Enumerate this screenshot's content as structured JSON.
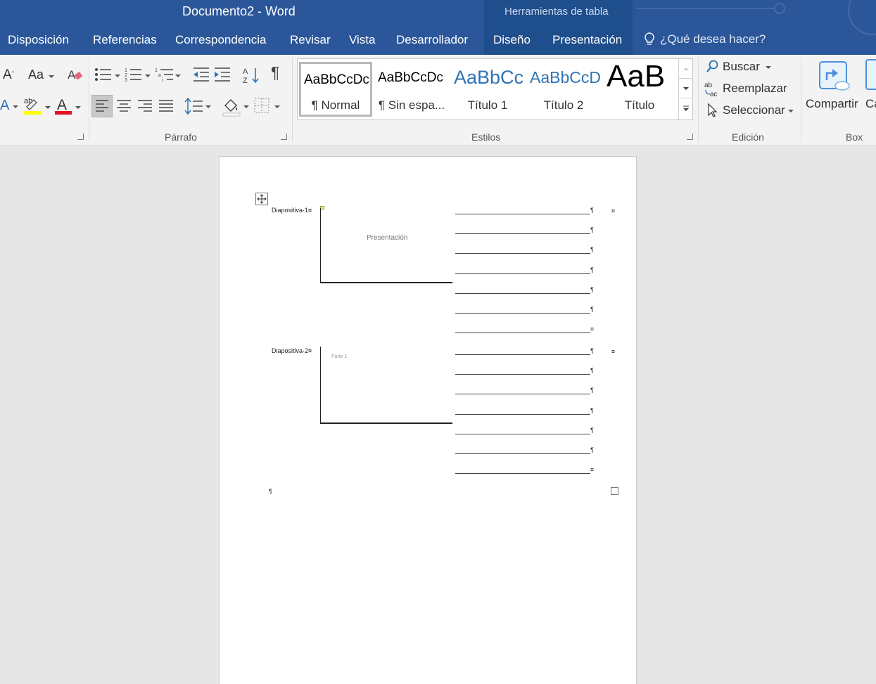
{
  "window": {
    "title": "Documento2 - Word",
    "contextual_title": "Herramientas de tabla"
  },
  "tabs": [
    {
      "label": "Disposición"
    },
    {
      "label": "Referencias"
    },
    {
      "label": "Correspondencia"
    },
    {
      "label": "Revisar"
    },
    {
      "label": "Vista"
    },
    {
      "label": "Desarrollador"
    },
    {
      "label": "Diseño"
    },
    {
      "label": "Presentación"
    }
  ],
  "tell_me": {
    "placeholder": "¿Qué desea hacer?"
  },
  "ribbon": {
    "font_group": {
      "change_case_label": "Aa"
    },
    "paragraph_group": {
      "label": "Párrafo",
      "show_marks": "¶"
    },
    "styles_group": {
      "label": "Estilos",
      "styles": [
        {
          "sample": "AaBbCcDc",
          "name": "¶ Normal"
        },
        {
          "sample": "AaBbCcDc",
          "name": "¶ Sin espa..."
        },
        {
          "sample": "AaBbCc",
          "name": "Título 1"
        },
        {
          "sample": "AaBbCcD",
          "name": "Título 2"
        },
        {
          "sample": "AaB",
          "name": "Título"
        }
      ]
    },
    "editing_group": {
      "label": "Edición",
      "find": "Buscar",
      "replace": "Reemplazar",
      "select": "Seleccionar",
      "replace_icon_top": "ab",
      "replace_icon_bottom": "ac"
    },
    "box_group": {
      "label": "Box",
      "share": "Compartir",
      "share2": "Ca"
    }
  },
  "document": {
    "slides": [
      {
        "label": "Diapositiva·1¤",
        "placeholder": "Presentación"
      },
      {
        "label": "Diapositiva·2¤",
        "placeholder": "Parte 1"
      }
    ],
    "para_mark": "¶",
    "cell_mark": "¤"
  },
  "colors": {
    "title_bar": "#2b579a",
    "contextual_tab": "#1f4e8c",
    "ribbon": "#f3f3f3",
    "highlight": "#ffff00",
    "font_color": "#e81123",
    "heading_blue": "#2e74b5"
  }
}
